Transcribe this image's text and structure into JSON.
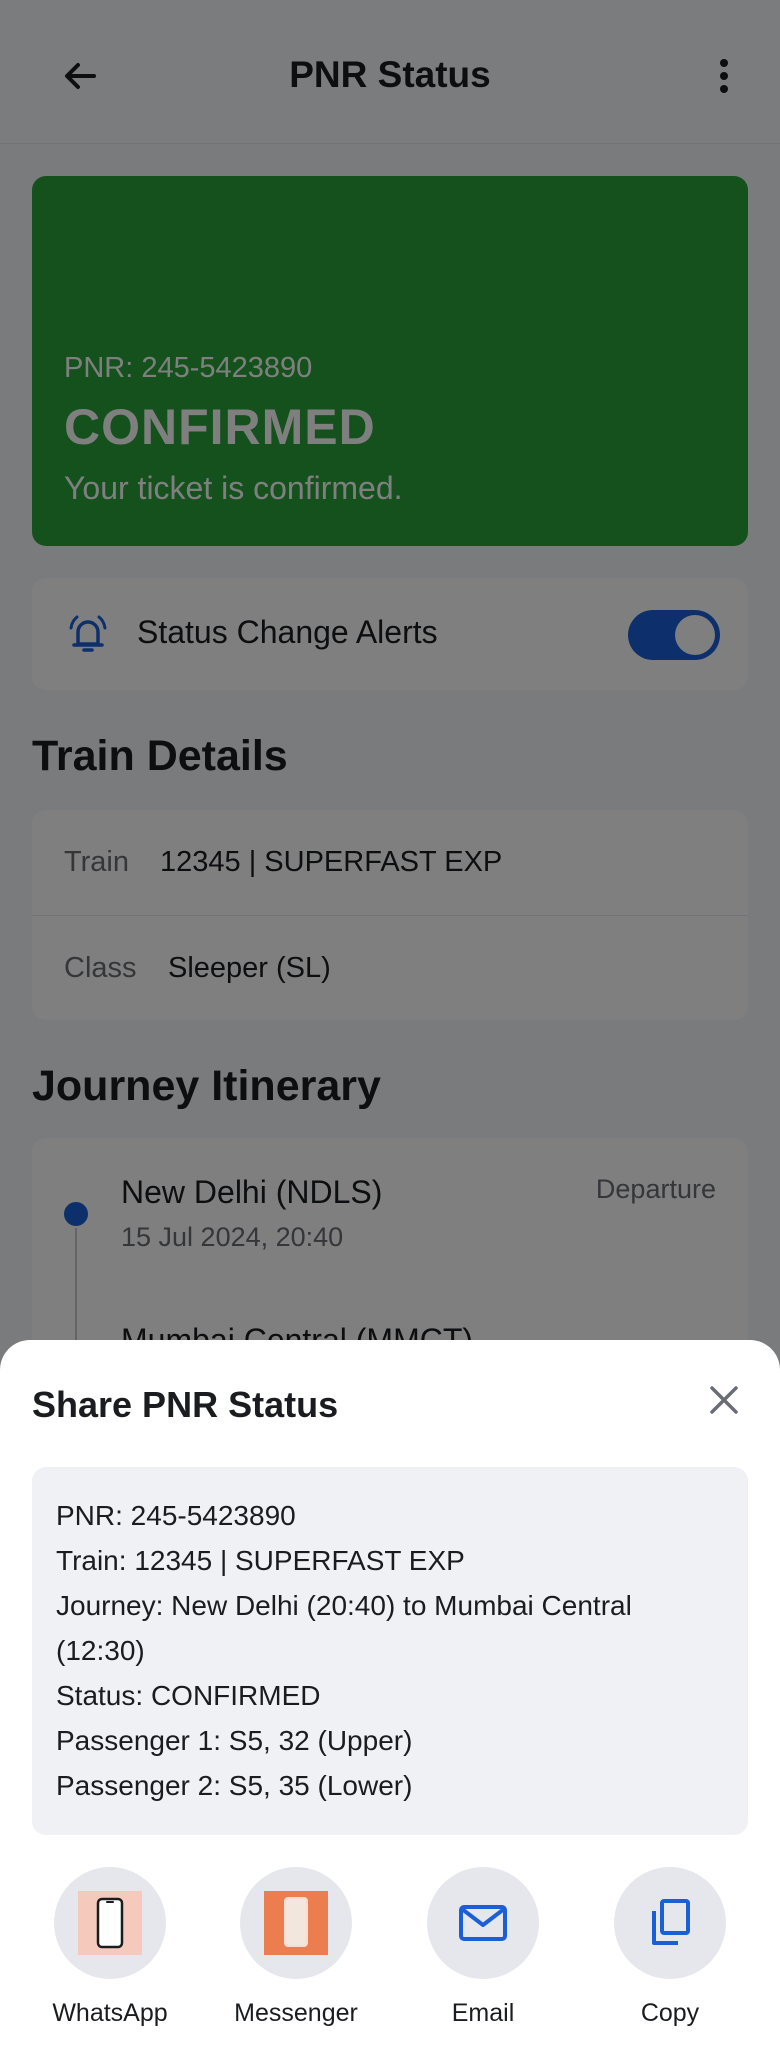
{
  "appbar": {
    "title": "PNR Status"
  },
  "status": {
    "pnr": "PNR: 245-5423890",
    "state": "CONFIRMED",
    "message": "Your ticket is confirmed."
  },
  "alerts": {
    "label": "Status Change Alerts",
    "enabled": true
  },
  "train_details": {
    "title": "Train Details",
    "rows": [
      {
        "key": "Train",
        "value": "12345 | SUPERFAST EXP"
      },
      {
        "key": "Class",
        "value": "Sleeper (SL)"
      }
    ]
  },
  "itinerary": {
    "title": "Journey Itinerary",
    "stops": [
      {
        "station": "New Delhi (NDLS)",
        "time": "15 Jul 2024, 20:40",
        "tag": "Departure"
      },
      {
        "station": "Mumbai Central (MMCT)"
      }
    ]
  },
  "share": {
    "title": "Share PNR Status",
    "lines": [
      "PNR: 245-5423890",
      "Train: 12345 | SUPERFAST EXP",
      "Journey: New Delhi (20:40) to Mumbai Central",
      "(12:30)",
      "Status: CONFIRMED",
      "Passenger 1: S5, 32 (Upper)",
      "Passenger 2: S5, 35 (Lower)"
    ],
    "options": [
      {
        "label": "WhatsApp",
        "icon": "phone-icon"
      },
      {
        "label": "Messenger",
        "icon": "phone-icon"
      },
      {
        "label": "Email",
        "icon": "mail-icon"
      },
      {
        "label": "Copy",
        "icon": "copy-icon"
      }
    ]
  },
  "colors": {
    "confirmed_green": "#2ba33a",
    "accent_blue": "#1a5fd6"
  }
}
